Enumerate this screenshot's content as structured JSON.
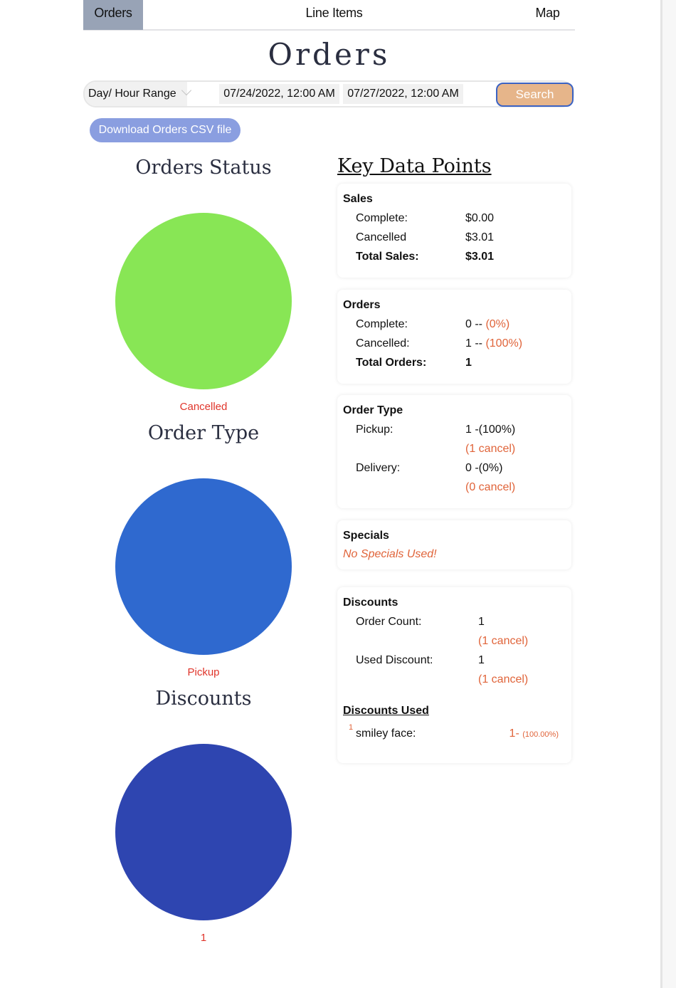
{
  "nav": {
    "tabs": [
      {
        "label": "Orders",
        "active": true
      },
      {
        "label": "Line Items",
        "active": false
      },
      {
        "label": "Map",
        "active": false
      }
    ]
  },
  "page": {
    "title": "Orders"
  },
  "search": {
    "range_type": "Day/ Hour Range",
    "start": "07/24/2022, 12:00 AM",
    "end": "07/27/2022, 12:00 AM",
    "button": "Search"
  },
  "download_label": "Download Orders CSV file",
  "charts": {
    "status": {
      "title": "Orders Status",
      "label": "Cancelled",
      "color": "#88e655"
    },
    "type": {
      "title": "Order Type",
      "label": "Pickup",
      "color": "#2f69cf"
    },
    "discounts": {
      "title": "Discounts",
      "label": "1",
      "color": "#2e45b0"
    }
  },
  "chart_data": [
    {
      "type": "pie",
      "title": "Orders Status",
      "categories": [
        "Cancelled"
      ],
      "values": [
        1
      ],
      "colors": [
        "#88e655"
      ]
    },
    {
      "type": "pie",
      "title": "Order Type",
      "categories": [
        "Pickup"
      ],
      "values": [
        1
      ],
      "colors": [
        "#2f69cf"
      ]
    },
    {
      "type": "pie",
      "title": "Discounts",
      "categories": [
        "1"
      ],
      "values": [
        1
      ],
      "colors": [
        "#2e45b0"
      ]
    }
  ],
  "kdp": {
    "title": "Key Data Points",
    "sales": {
      "title": "Sales",
      "complete_label": "Complete:",
      "complete": "$0.00",
      "cancelled_label": "Cancelled",
      "cancelled": "$3.01",
      "total_label": "Total Sales:",
      "total": "$3.01"
    },
    "orders": {
      "title": "Orders",
      "complete_label": "Complete:",
      "complete": "0 --",
      "complete_pct": "(0%)",
      "cancelled_label": "Cancelled:",
      "cancelled": "1 --",
      "cancelled_pct": "(100%)",
      "total_label": "Total Orders:",
      "total": "1"
    },
    "order_type": {
      "title": "Order Type",
      "pickup_label": "Pickup:",
      "pickup": "1 -(100%)",
      "pickup_cancel": "(1 cancel)",
      "delivery_label": "Delivery:",
      "delivery": "0 -(0%)",
      "delivery_cancel": "(0 cancel)"
    },
    "specials": {
      "title": "Specials",
      "message": "No Specials Used!"
    },
    "discounts": {
      "title": "Discounts",
      "order_count_label": "Order Count:",
      "order_count": "1",
      "order_count_cancel": "(1 cancel)",
      "used_label": "Used Discount:",
      "used": "1",
      "used_cancel": "(1 cancel)",
      "used_title": "Discounts Used",
      "items": [
        {
          "index": "1",
          "name": "smiley face:",
          "count": "1-",
          "pct": "(100.00%)"
        }
      ]
    }
  }
}
